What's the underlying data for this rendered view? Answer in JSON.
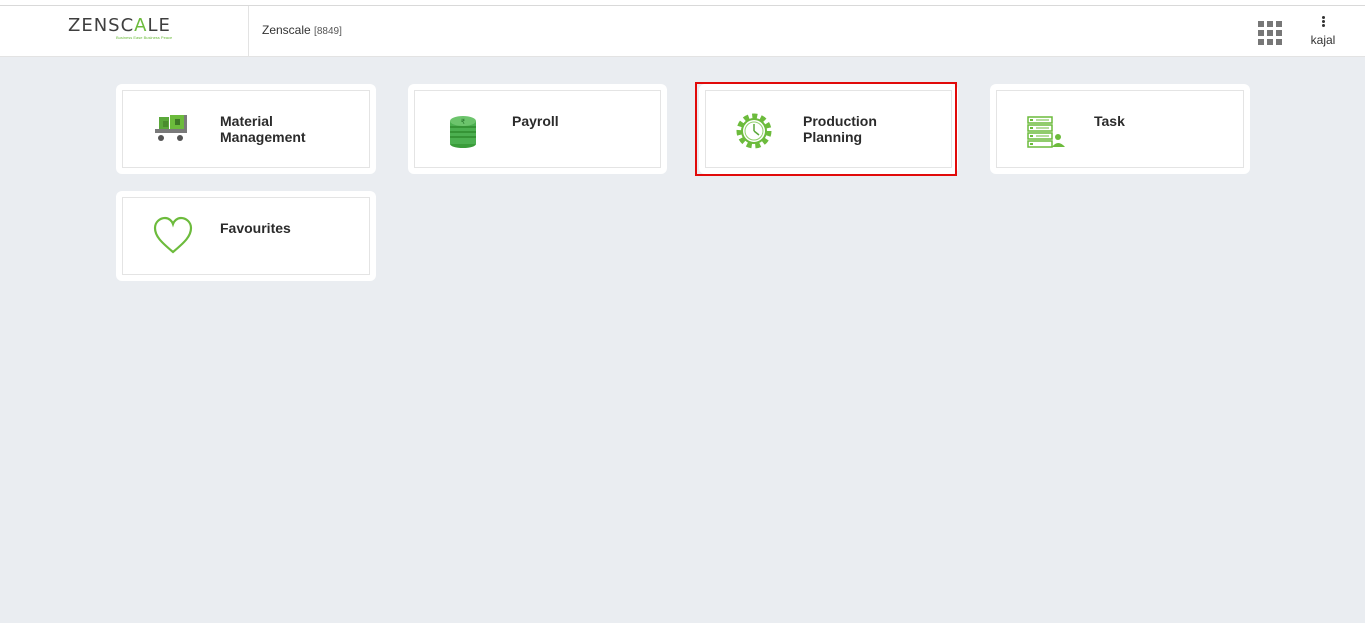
{
  "header": {
    "logo_main": "ZENSC",
    "logo_accent": "A",
    "logo_end": "LE",
    "logo_tagline": "Business Ease Business Peace",
    "company_name": "Zenscale",
    "company_id": "[8849]",
    "user_name": "kajal"
  },
  "modules": [
    {
      "label": "Material Management",
      "icon": "cart-icon"
    },
    {
      "label": "Payroll",
      "icon": "coins-icon"
    },
    {
      "label": "Production Planning",
      "icon": "gear-clock-icon"
    },
    {
      "label": "Task",
      "icon": "task-list-icon"
    },
    {
      "label": "Favourites",
      "icon": "heart-icon"
    }
  ],
  "colors": {
    "accent": "#6cbb3c",
    "highlight": "#e10a0a",
    "background": "#eaedf1"
  }
}
